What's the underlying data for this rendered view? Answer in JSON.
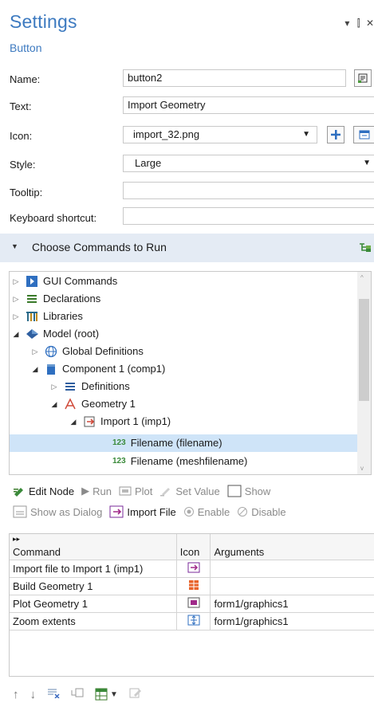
{
  "header": {
    "title": "Settings",
    "subtitle": "Button",
    "controls": "▾ ⫿ ✕"
  },
  "form": {
    "name_label": "Name:",
    "name_value": "button2",
    "text_label": "Text:",
    "text_value": "Import Geometry",
    "icon_label": "Icon:",
    "icon_value": "import_32.png",
    "style_label": "Style:",
    "style_value": "Large",
    "tooltip_label": "Tooltip:",
    "tooltip_value": "",
    "shortcut_label": "Keyboard shortcut:",
    "shortcut_value": ""
  },
  "section": {
    "label": "Choose Commands to Run"
  },
  "tree": {
    "gui_commands": "GUI Commands",
    "declarations": "Declarations",
    "libraries": "Libraries",
    "model_root": "Model (root)",
    "global_definitions": "Global Definitions",
    "component1": "Component 1 (comp1)",
    "definitions": "Definitions",
    "geometry1": "Geometry 1",
    "import1": "Import 1 (imp1)",
    "filename": "Filename (filename)",
    "meshfilename": "Filename (meshfilename)",
    "num_tag": "123"
  },
  "toolbar": {
    "edit_node": "Edit Node",
    "run": "Run",
    "plot": "Plot",
    "set_value": "Set Value",
    "show": "Show",
    "show_as_dialog": "Show as Dialog",
    "import_file": "Import File",
    "enable": "Enable",
    "disable": "Disable"
  },
  "table": {
    "headers": [
      "Command",
      "Icon",
      "Arguments"
    ],
    "rows": [
      {
        "command": "Import file to Import 1 (imp1)",
        "arguments": ""
      },
      {
        "command": "Build Geometry 1",
        "arguments": ""
      },
      {
        "command": "Plot Geometry 1",
        "arguments": "form1/graphics1"
      },
      {
        "command": "Zoom extents",
        "arguments": "form1/graphics1"
      }
    ]
  },
  "colors": {
    "accent": "#3d7ac0",
    "section_bg": "#e4ebf4",
    "selection": "#cfe4f8"
  }
}
